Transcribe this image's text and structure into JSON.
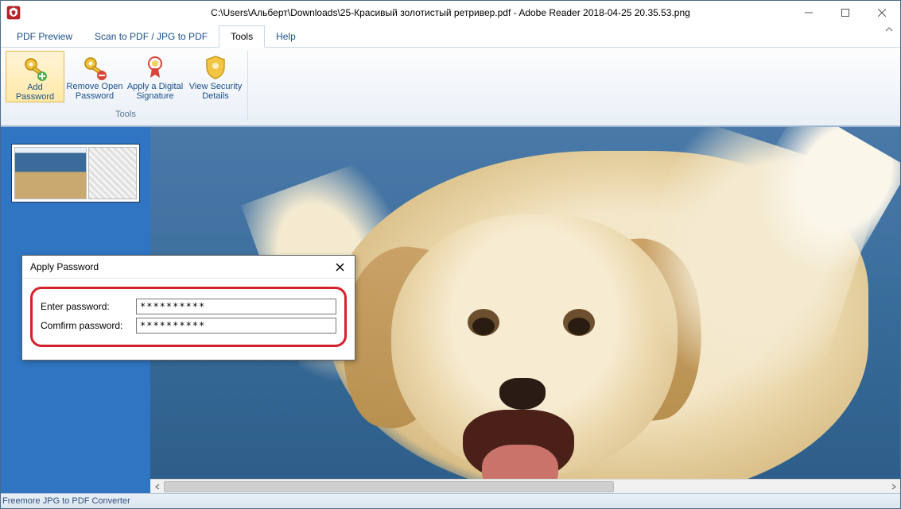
{
  "window": {
    "title": "C:\\Users\\Альберт\\Downloads\\25-Красивый золотистый ретривер.pdf - Adobe Reader 2018-04-25 20.35.53.png"
  },
  "tabs": {
    "pdf_preview": "PDF Preview",
    "scan_to_pdf": "Scan to PDF / JPG to PDF",
    "tools": "Tools",
    "help": "Help",
    "active": "tools"
  },
  "ribbon": {
    "group_tools_label": "Tools",
    "add_password": "Add Password",
    "remove_open_password": "Remove Open Password",
    "apply_digital_signature": "Apply a Digital Signature",
    "view_security_details": "View Security Details"
  },
  "dialog": {
    "title": "Apply Password",
    "enter_label": "Enter password:",
    "confirm_label": "Comfirm password:",
    "enter_value": "**********",
    "confirm_value": "**********"
  },
  "status": {
    "text": "Freemore JPG to PDF Converter"
  }
}
